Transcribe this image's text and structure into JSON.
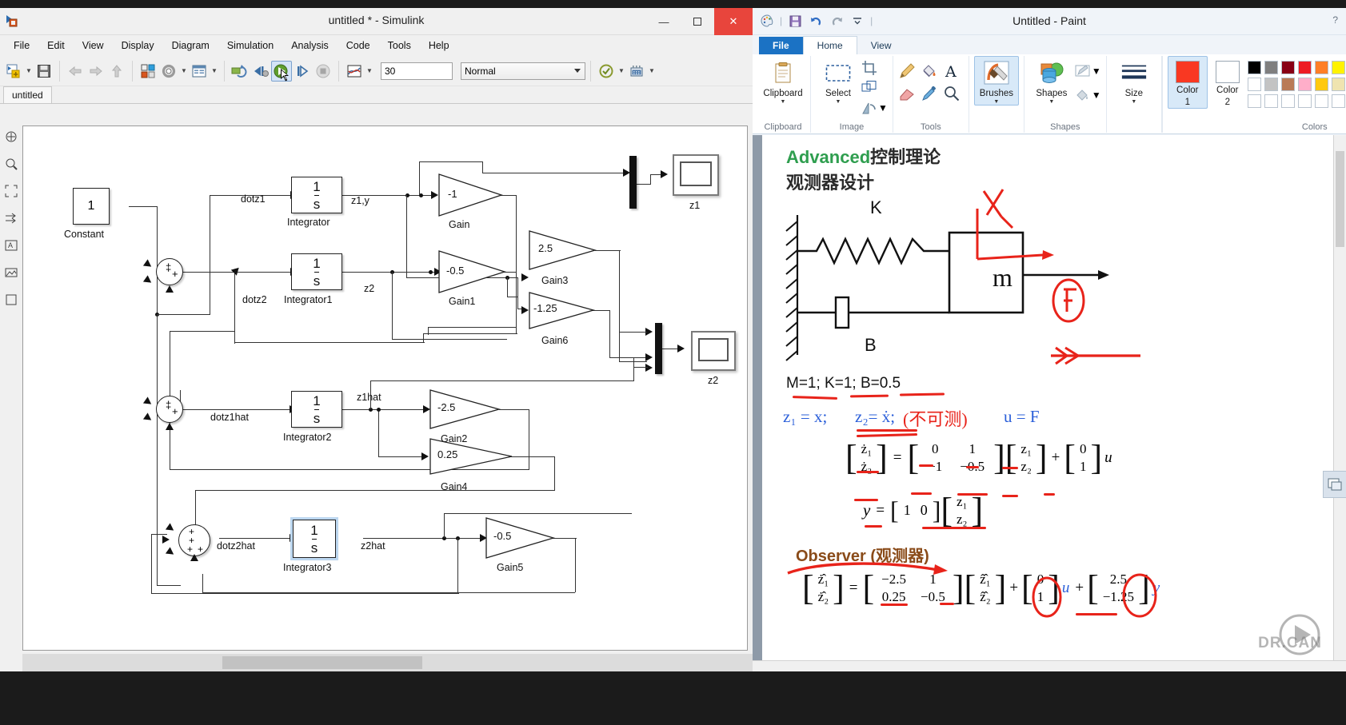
{
  "simulink": {
    "window_title": "untitled * - Simulink",
    "app_icon": "simulink-icon",
    "window_buttons": [
      {
        "name": "minimize-button",
        "glyph": "—"
      },
      {
        "name": "maximize-button",
        "glyph": "❑"
      },
      {
        "name": "close-button",
        "glyph": "✕"
      }
    ],
    "menus": [
      "File",
      "Edit",
      "View",
      "Display",
      "Diagram",
      "Simulation",
      "Analysis",
      "Code",
      "Tools",
      "Help"
    ],
    "toolbar": {
      "new_model": "new-model-icon",
      "save": "save-icon",
      "back": "back-arrow-icon",
      "forward": "forward-arrow-icon",
      "up": "up-arrow-icon",
      "library_browser": "library-browser-icon",
      "model_configuration": "gear-icon",
      "model_explorer": "model-explorer-icon",
      "update_diagram": "update-diagram-icon",
      "step_back": "step-back-icon",
      "run": "run-icon",
      "step_forward": "step-forward-icon",
      "stop": "stop-icon",
      "data_inspector": "data-inspector-icon",
      "stop_time_value": "30",
      "sim_mode_value": "Normal",
      "model_advisor": "model-advisor-icon",
      "build": "build-icon"
    },
    "tab_label": "untitled",
    "palette_icons": [
      "pan-icon",
      "zoom-icon",
      "fit-to-view-icon",
      "resize-icon",
      "annotation-icon",
      "image-icon",
      "area-icon"
    ],
    "diagram": {
      "constant": {
        "value": "1",
        "label": "Constant"
      },
      "integrators": [
        {
          "expr_num": "1",
          "expr_den": "s",
          "label": "Integrator",
          "in_signal": "dotz1",
          "out_signal": "z1,y"
        },
        {
          "expr_num": "1",
          "expr_den": "s",
          "label": "Integrator1",
          "in_signal": "dotz2",
          "out_signal": "z2"
        },
        {
          "expr_num": "1",
          "expr_den": "s",
          "label": "Integrator2",
          "in_signal": "dotz1hat",
          "out_signal": "z1hat"
        },
        {
          "expr_num": "1",
          "expr_den": "s",
          "label": "Integrator3",
          "in_signal": "dotz2hat",
          "out_signal": "z2hat",
          "selected": true
        }
      ],
      "gains": [
        {
          "value": "-1",
          "label": "Gain"
        },
        {
          "value": "-0.5",
          "label": "Gain1"
        },
        {
          "value": "2.5",
          "label": "Gain3"
        },
        {
          "value": "-1.25",
          "label": "Gain6"
        },
        {
          "value": "-2.5",
          "label": "Gain2"
        },
        {
          "value": "0.25",
          "label": "Gain4"
        },
        {
          "value": "-0.5",
          "label": "Gain5"
        }
      ],
      "scopes": [
        {
          "label": "z1"
        },
        {
          "label": "z2"
        }
      ],
      "sum_signs": [
        "+",
        "+",
        "+"
      ]
    }
  },
  "paint": {
    "window_title": "Untitled - Paint",
    "help_glyph": "?",
    "quick_access": [
      "paint-app-icon",
      "save-icon",
      "undo-icon",
      "redo-icon",
      "customize-qat-icon"
    ],
    "tabs": [
      {
        "label": "File",
        "kind": "file"
      },
      {
        "label": "Home",
        "kind": "active"
      },
      {
        "label": "View",
        "kind": "normal"
      }
    ],
    "ribbon": {
      "groups": [
        {
          "title": "Clipboard",
          "name": "clipboard-group"
        },
        {
          "title": "Image",
          "name": "image-group"
        },
        {
          "title": "Tools",
          "name": "tools-group"
        },
        {
          "title": "Shapes",
          "name": "shapes-group"
        },
        {
          "title": "Colors",
          "name": "colors-group"
        }
      ],
      "clipboard_label": "Clipboard",
      "select_label": "Select",
      "crop_icon": "crop-icon",
      "resize_icon": "resize-icon",
      "rotate_icon": "rotate-icon",
      "tool_icons": [
        "pencil-icon",
        "fill-bucket-icon",
        "text-icon",
        "eraser-icon",
        "color-picker-icon",
        "magnifier-icon"
      ],
      "brushes_label": "Brushes",
      "shapes_label": "Shapes",
      "outline_icon": "outline-icon",
      "fill_icon": "fill-icon",
      "size_label": "Size",
      "color1_label": "Color\n1",
      "color1_line1": "Color",
      "color1_line2": "1",
      "color2_line1": "Color",
      "color2_line2": "2",
      "color1_value": "#f93822",
      "color2_value": "#ffffff",
      "palette_row1": [
        "#000000",
        "#7f7f7f",
        "#880015",
        "#ed1c24",
        "#ff7f27",
        "#fff200",
        "#22b14c",
        "#00a2e8",
        "#3f48cc",
        "#a349a4"
      ],
      "palette_row2": [
        "#ffffff",
        "#c3c3c3",
        "#b97a57",
        "#ffaec9",
        "#ffc90e",
        "#efe4b0",
        "#b5e61d",
        "#99d9ea",
        "#7092be",
        "#c8bfe7"
      ],
      "palette_row3": [
        "#ffffff",
        "#ffffff",
        "#ffffff",
        "#ffffff",
        "#ffffff",
        "#ffffff",
        "#ffffff",
        "#ffffff",
        "#ffffff",
        "#ffffff"
      ]
    },
    "canvas": {
      "title_en": "Advanced",
      "title_cn": "控制理论",
      "subtitle_cn": "观测器设计",
      "spring_label": "K",
      "damper_label": "B",
      "mass_label": "m",
      "force_label": "F",
      "coord_label": "x",
      "params": "M=1; K=1; B=0.5",
      "defs_z1": "z₁ = x;",
      "defs_z2": "z₂= ẋ;",
      "defs_note": "(不可测)",
      "defs_u": "u = F",
      "state_eq": {
        "lhs": [
          "ż₁",
          "ż₂"
        ],
        "A": [
          [
            "0",
            "1"
          ],
          [
            "−1",
            "−0.5"
          ]
        ],
        "x": [
          "z₁",
          "z₂"
        ],
        "B": [
          "0",
          "1"
        ],
        "u": "u",
        "eq": "=",
        "plus": "+"
      },
      "output_eq": {
        "y": "y",
        "eq": "=",
        "C": [
          "1",
          "0"
        ],
        "x": [
          "z₁",
          "z₂"
        ]
      },
      "observer_title_en": "Observer",
      "observer_title_cn": "(观测器)",
      "observer_eq": {
        "lhs": [
          "ż̂₁",
          "ż̂₂"
        ],
        "A": [
          [
            "−2.5",
            "1"
          ],
          [
            "0.25",
            "−0.5"
          ]
        ],
        "x": [
          "ẑ̂₁",
          "ẑ̂₂"
        ],
        "B": [
          "0",
          "1"
        ],
        "u": "u",
        "L": [
          "2.5",
          "−1.25"
        ],
        "y": "y",
        "eq": "=",
        "plus": "+"
      },
      "watermark": "DR.CAN"
    }
  }
}
